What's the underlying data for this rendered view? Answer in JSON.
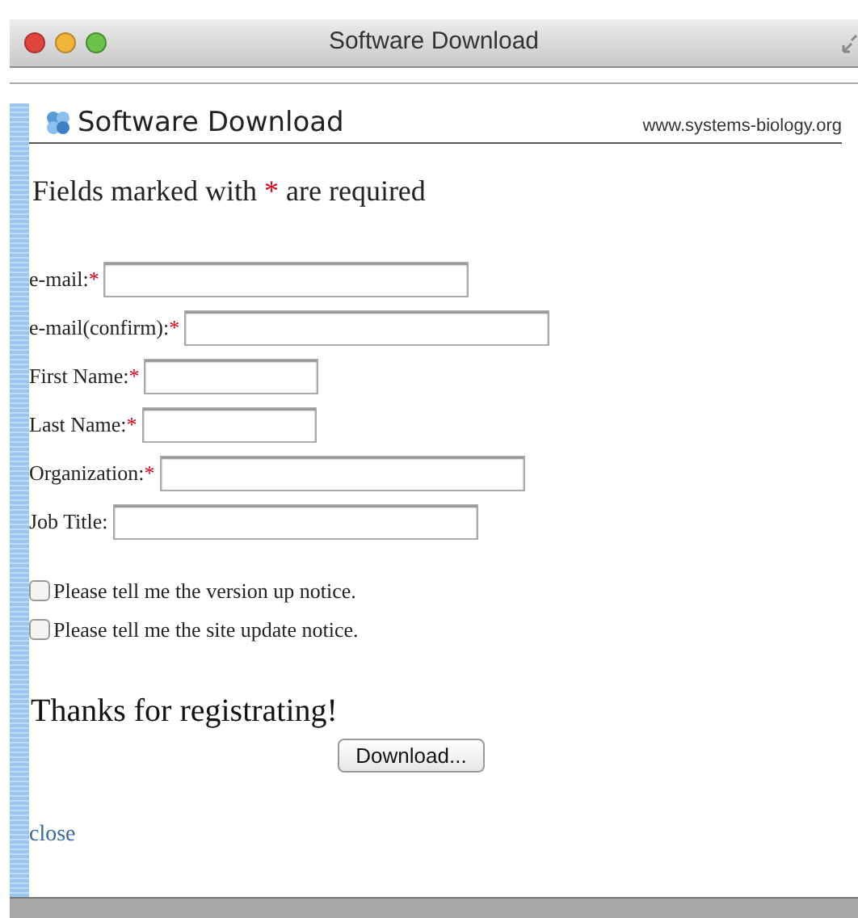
{
  "window": {
    "title": "Software Download"
  },
  "header": {
    "title": "Software Download",
    "site": "www.systems-biology.org"
  },
  "required_note": {
    "before": "Fields marked with",
    "mark": "*",
    "after": "are required"
  },
  "fields": [
    {
      "label": "e-mail:",
      "required": true,
      "mark": "*",
      "kind": "long"
    },
    {
      "label": "e-mail(confirm):",
      "required": true,
      "mark": "*",
      "kind": "long"
    },
    {
      "label": "First Name:",
      "required": true,
      "mark": "*",
      "kind": "short"
    },
    {
      "label": "Last Name:",
      "required": true,
      "mark": "*",
      "kind": "short"
    },
    {
      "label": "Organization:",
      "required": true,
      "mark": "*",
      "kind": "long"
    },
    {
      "label": "Job Title:",
      "required": false,
      "kind": "long"
    }
  ],
  "options": [
    {
      "label": "Please tell me the version up notice.",
      "checked": false
    },
    {
      "label": "Please tell me the site update notice.",
      "checked": false
    }
  ],
  "thanks": "Thanks for registrating!",
  "download_button": "Download...",
  "close_link": "close"
}
